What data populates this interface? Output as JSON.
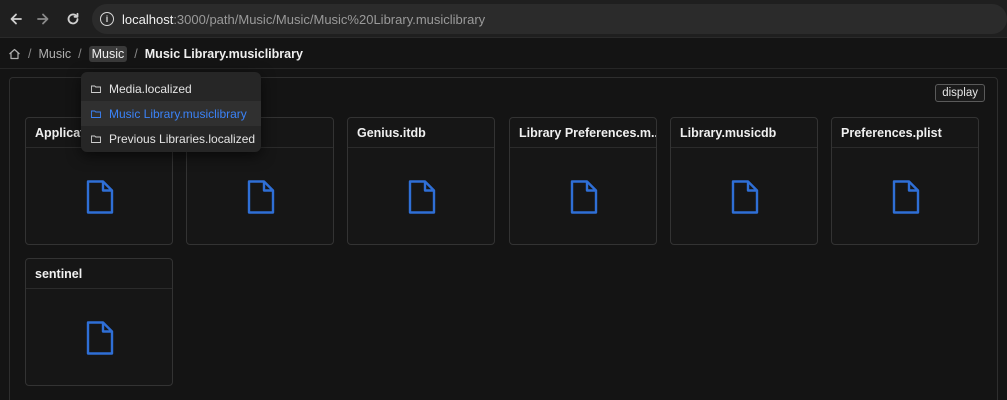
{
  "browser": {
    "url_host": "localhost",
    "url_path": ":3000/path/Music/Music/Music%20Library.musiclibrary"
  },
  "breadcrumb": {
    "items": [
      "Music",
      "Music"
    ],
    "current": "Music Library.musiclibrary",
    "separator": "/"
  },
  "toolbar": {
    "display_label": "display"
  },
  "dropdown": {
    "items": [
      {
        "label": "Media.localized",
        "selected": false
      },
      {
        "label": "Music Library.musiclibrary",
        "selected": true
      },
      {
        "label": "Previous Libraries.localized",
        "selected": false
      }
    ]
  },
  "files": [
    {
      "name": "Applicat"
    },
    {
      "name": ""
    },
    {
      "name": "Genius.itdb"
    },
    {
      "name": "Library Preferences.m..."
    },
    {
      "name": "Library.musicdb"
    },
    {
      "name": "Preferences.plist"
    },
    {
      "name": "sentinel"
    }
  ],
  "colors": {
    "accent": "#3b82f6",
    "icon_blue": "#2f6fd6",
    "background": "#141414"
  }
}
